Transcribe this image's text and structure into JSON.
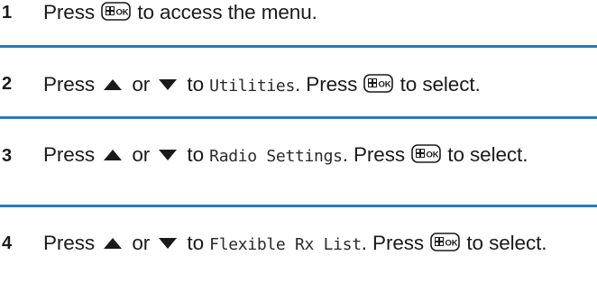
{
  "steps": [
    {
      "number": "1",
      "parts": [
        {
          "t": "text",
          "v": "Press "
        },
        {
          "t": "ok"
        },
        {
          "t": "text",
          "v": " to access the menu."
        }
      ]
    },
    {
      "number": "2",
      "parts": [
        {
          "t": "text",
          "v": "Press "
        },
        {
          "t": "up"
        },
        {
          "t": "text",
          "v": " or "
        },
        {
          "t": "down"
        },
        {
          "t": "text",
          "v": " to "
        },
        {
          "t": "mono",
          "v": "Utilities"
        },
        {
          "t": "text",
          "v": ". Press "
        },
        {
          "t": "ok"
        },
        {
          "t": "text",
          "v": " to select."
        }
      ]
    },
    {
      "number": "3",
      "parts": [
        {
          "t": "text",
          "v": "Press "
        },
        {
          "t": "up"
        },
        {
          "t": "text",
          "v": " or "
        },
        {
          "t": "down"
        },
        {
          "t": "text",
          "v": " to "
        },
        {
          "t": "mono",
          "v": "Radio Settings"
        },
        {
          "t": "text",
          "v": ". Press "
        },
        {
          "t": "ok"
        },
        {
          "t": "text",
          "v": " to select."
        }
      ]
    },
    {
      "number": "4",
      "parts": [
        {
          "t": "text",
          "v": "Press "
        },
        {
          "t": "up"
        },
        {
          "t": "text",
          "v": " or "
        },
        {
          "t": "down"
        },
        {
          "t": "text",
          "v": " to "
        },
        {
          "t": "mono",
          "v": "Flexible Rx List"
        },
        {
          "t": "text",
          "v": ". Press "
        },
        {
          "t": "ok"
        },
        {
          "t": "text",
          "v": " to select."
        }
      ]
    }
  ],
  "icons": {
    "ok_button": "menu-ok-button-icon",
    "up": "up-arrow-icon",
    "down": "down-arrow-icon"
  },
  "colors": {
    "divider": "#2a7ab8",
    "text": "#1a1a1a"
  }
}
